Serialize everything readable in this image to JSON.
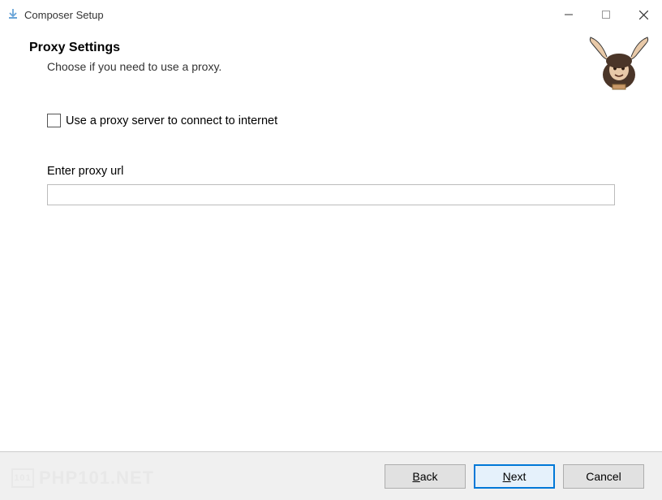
{
  "titlebar": {
    "title": "Composer Setup"
  },
  "header": {
    "title": "Proxy Settings",
    "subtitle": "Choose if you need to use a proxy."
  },
  "content": {
    "checkbox_label": "Use a proxy server to connect to internet",
    "field_label": "Enter proxy url",
    "proxy_url": ""
  },
  "footer": {
    "back": "Back",
    "next": "Next",
    "cancel": "Cancel"
  },
  "watermark": {
    "text": "PHP101.NET"
  }
}
